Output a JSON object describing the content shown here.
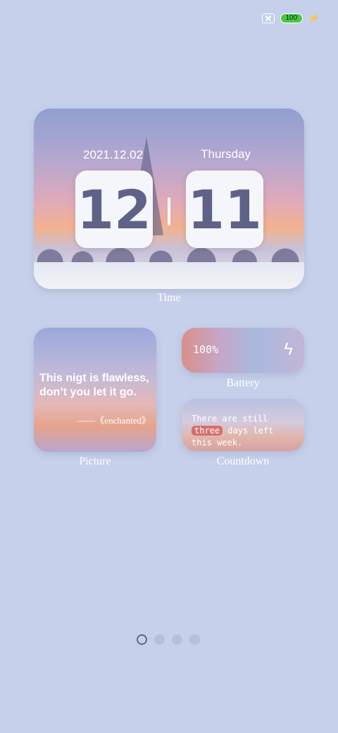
{
  "status_bar": {
    "battery_level": "100"
  },
  "time_widget": {
    "date": "2021.12.02",
    "weekday": "Thursday",
    "hour": "12",
    "minute": "11",
    "label": "Time"
  },
  "picture_widget": {
    "quote_line1": "This nigt is flawless,",
    "quote_line2": "don’t you let it go.",
    "source": "——《enchanted》",
    "label": "Picture"
  },
  "battery_widget": {
    "percent": "100%",
    "label": "Battery"
  },
  "countdown_widget": {
    "prefix": "There are still",
    "highlight": "three",
    "suffix": "days left this week.",
    "label": "Countdown"
  },
  "pagination": {
    "current": 1,
    "total": 4
  },
  "colors": {
    "background": "#c6d0ea",
    "digit": "#5f6288",
    "highlight": "#d46f6d"
  }
}
